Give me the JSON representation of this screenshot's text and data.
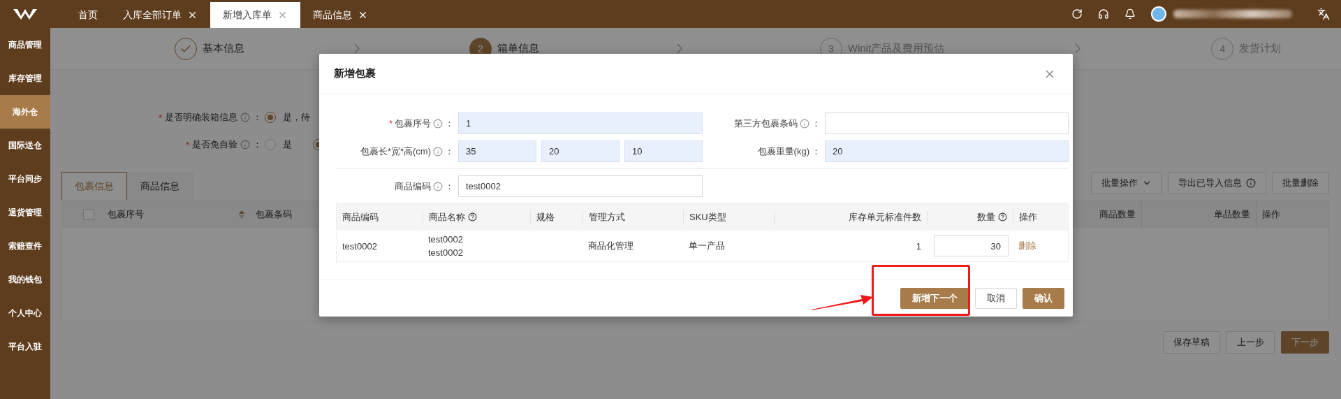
{
  "top_tabs": [
    {
      "label": "首页",
      "closable": false,
      "selected": false
    },
    {
      "label": "入库全部订单",
      "closable": true,
      "selected": false
    },
    {
      "label": "新增入库单",
      "closable": true,
      "selected": true
    },
    {
      "label": "商品信息",
      "closable": true,
      "selected": false
    }
  ],
  "sidebar": {
    "items": [
      {
        "label": "商品管理",
        "selected": false
      },
      {
        "label": "库存管理",
        "selected": false
      },
      {
        "label": "海外仓",
        "selected": true
      },
      {
        "label": "国际送仓",
        "selected": false
      },
      {
        "label": "平台同步",
        "selected": false
      },
      {
        "label": "退货管理",
        "selected": false
      },
      {
        "label": "索赔查件",
        "selected": false
      },
      {
        "label": "我的钱包",
        "selected": false
      },
      {
        "label": "个人中心",
        "selected": false
      },
      {
        "label": "平台入驻",
        "selected": false
      }
    ]
  },
  "steps": [
    {
      "kind": "done",
      "label": "基本信息"
    },
    {
      "kind": "current",
      "number": "2",
      "label": "箱单信息"
    },
    {
      "kind": "pending",
      "number": "3",
      "label": "Winit产品及费用预估"
    },
    {
      "kind": "pending",
      "number": "4",
      "label": "发货计划"
    }
  ],
  "form": [
    {
      "required_mark": "*",
      "label": "是否明确装箱信息",
      "separator": "：",
      "options": [
        {
          "label": "是，待",
          "selected": true
        }
      ]
    },
    {
      "required_mark": "*",
      "label": "是否免自验",
      "separator": "：",
      "options": [
        {
          "label": "是",
          "selected": false
        },
        {
          "selected": true
        }
      ]
    }
  ],
  "content_tabs": [
    {
      "label": "包裹信息",
      "selected": true
    },
    {
      "label": "商品信息",
      "selected": false
    }
  ],
  "toolbar_buttons": [
    {
      "label": "批量操作",
      "kind": "dropdown"
    },
    {
      "label": "导出已导入信息",
      "kind": "info"
    },
    {
      "label": "批量删除",
      "kind": "plain"
    }
  ],
  "table": {
    "select_all_checked": false,
    "columns": [
      {
        "label": "包裹序号",
        "sortable": true
      },
      {
        "label": "包裹条码",
        "sortable": false
      },
      {
        "label": "商品数量",
        "sortable": false
      },
      {
        "label": "单品数量",
        "sortable": false
      },
      {
        "label": "操作",
        "sortable": false
      }
    ]
  },
  "footer_buttons": [
    {
      "label": "保存草稿",
      "primary": false
    },
    {
      "label": "上一步",
      "primary": false
    },
    {
      "label": "下一步",
      "primary": true
    }
  ],
  "modal": {
    "title": "新增包裹",
    "rows": [
      {
        "divider_before": false,
        "fields": [
          {
            "required_mark": "*",
            "label": "包裹序号",
            "info": true,
            "separator": "：",
            "inputs": [
              {
                "value": "1",
                "highlighted": true
              }
            ]
          },
          {
            "label": "第三方包裹条码",
            "info": true,
            "separator": "：",
            "inputs": [
              {
                "highlighted": false
              }
            ]
          }
        ]
      },
      {
        "divider_before": false,
        "fields": [
          {
            "label": "包裹长*宽*高(cm)",
            "info": true,
            "separator": "：",
            "inputs": [
              {
                "value": "35",
                "highlighted": true
              },
              {
                "value": "20",
                "highlighted": true
              },
              {
                "value": "10",
                "highlighted": true
              }
            ]
          },
          {
            "label": "包裹重量(kg)",
            "info": false,
            "separator": "：",
            "inputs": [
              {
                "value": "20",
                "highlighted": true
              }
            ]
          }
        ]
      },
      {
        "divider_before": true,
        "fields": [
          {
            "label": "商品编码",
            "info": true,
            "separator": "：",
            "inputs": [
              {
                "value": "test0002",
                "highlighted": false
              }
            ]
          }
        ]
      }
    ],
    "table": {
      "columns": [
        {
          "label": "商品编码",
          "help": false
        },
        {
          "label": "商品名称",
          "help": true
        },
        {
          "label": "规格",
          "help": false
        },
        {
          "label": "管理方式",
          "help": false
        },
        {
          "label": "SKU类型",
          "help": false
        },
        {
          "label": "库存单元标准件数",
          "help": false
        },
        {
          "label": "数量",
          "help": true
        },
        {
          "label": "操作",
          "help": false
        }
      ],
      "rows": [
        {
          "code": "test0002",
          "name_lines": [
            "test0002",
            "test0002"
          ],
          "management": "商品化管理",
          "sku_type": "单一产品",
          "standard_units": "1",
          "quantity": "30",
          "action": "删除"
        }
      ]
    },
    "buttons": [
      {
        "label": "新增下一个",
        "kind": "primary"
      },
      {
        "label": "取消",
        "kind": "default"
      },
      {
        "label": "确认",
        "kind": "primary"
      }
    ]
  }
}
